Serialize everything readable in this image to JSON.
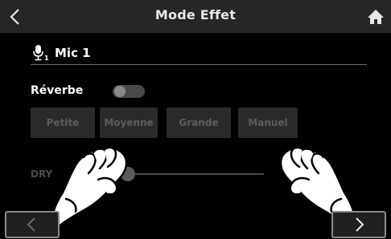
{
  "header": {
    "title": "Mode Effet",
    "back_icon": "chevron-left-icon",
    "home_icon": "home-icon"
  },
  "channel": {
    "icon": "microphone-icon",
    "icon_index": "1",
    "name": "Mic 1"
  },
  "reverb": {
    "label": "Réverbe",
    "enabled": false
  },
  "types": [
    {
      "label": "Petite"
    },
    {
      "label": "Moyenne"
    },
    {
      "label": "Grande"
    },
    {
      "label": "Manuel"
    }
  ],
  "mix": {
    "label": "DRY"
  },
  "nav": {
    "prev_icon": "chevron-left-icon",
    "next_icon": "chevron-right-icon"
  },
  "colors": {
    "header_bg": "#262626",
    "button_bg": "#2a2a2a",
    "disabled_text": "#5c5c5c"
  }
}
